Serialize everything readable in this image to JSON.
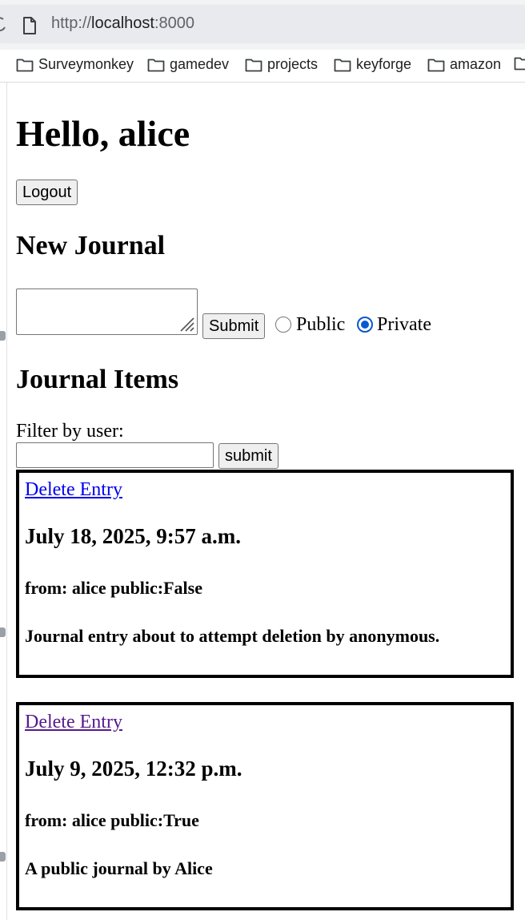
{
  "browser": {
    "url_scheme": "http://",
    "url_host": "localhost",
    "url_port": ":8000",
    "bookmarks": [
      {
        "label": "Surveymonkey",
        "icon": "folder-icon"
      },
      {
        "label": "gamedev",
        "icon": "folder-icon"
      },
      {
        "label": "projects",
        "icon": "folder-icon"
      },
      {
        "label": "keyforge",
        "icon": "folder-icon"
      },
      {
        "label": "amazon",
        "icon": "folder-icon"
      }
    ]
  },
  "page": {
    "greeting": "Hello, alice",
    "logout_label": "Logout",
    "new_journal_heading": "New Journal",
    "journal_text_value": "",
    "submit_label": "Submit",
    "visibility": {
      "options": [
        "Public",
        "Private"
      ],
      "selected": "Private"
    },
    "journal_items_heading": "Journal Items",
    "filter_label": "Filter by user:",
    "filter_value": "",
    "filter_submit_label": "submit"
  },
  "entries": [
    {
      "delete_label": "Delete Entry",
      "date": "July 18, 2025, 9:57 a.m.",
      "meta": "from: alice public:False",
      "text": "Journal entry about to attempt deletion by anonymous.",
      "link_color": "#0000ee"
    },
    {
      "delete_label": "Delete Entry",
      "date": "July 9, 2025, 12:32 p.m.",
      "meta": "from: alice public:True",
      "text": "A public journal by Alice",
      "link_color": "#551a8b"
    }
  ],
  "colors": {
    "radio_accent": "#0b57d0",
    "link_unvisited": "#0000ee",
    "link_visited": "#551a8b"
  }
}
